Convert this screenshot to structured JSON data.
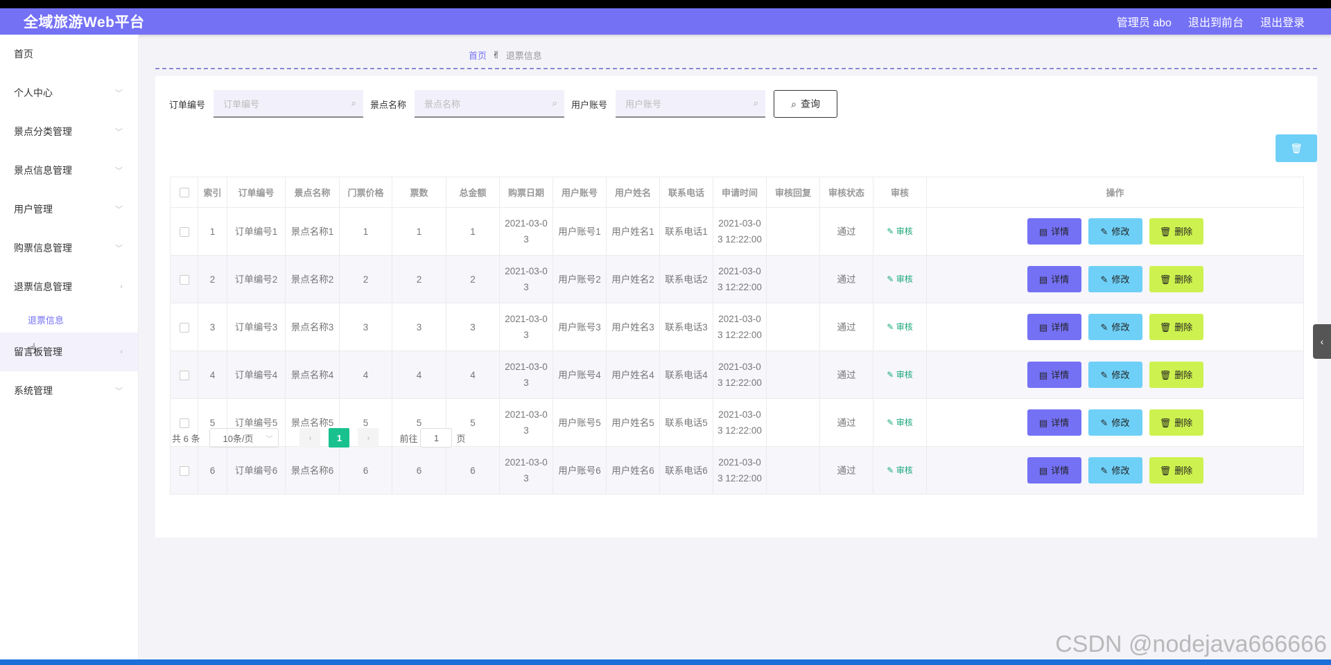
{
  "app": {
    "title": "全域旅游Web平台",
    "admin_label": "管理员 abo",
    "to_front": "退出到前台",
    "logout": "退出登录"
  },
  "sidebar": {
    "items": [
      {
        "label": "首页",
        "chevron": ""
      },
      {
        "label": "个人中心",
        "chevron": "﹀"
      },
      {
        "label": "景点分类管理",
        "chevron": "﹀"
      },
      {
        "label": "景点信息管理",
        "chevron": "﹀"
      },
      {
        "label": "用户管理",
        "chevron": "﹀"
      },
      {
        "label": "购票信息管理",
        "chevron": "﹀"
      },
      {
        "label": "退票信息管理",
        "chevron": "‹"
      },
      {
        "label": "留言板管理",
        "chevron": "‹"
      },
      {
        "label": "系统管理",
        "chevron": "﹀"
      }
    ],
    "submenu": "退票信息"
  },
  "breadcrumb": {
    "home": "首页",
    "icon": "✌",
    "current": "退票信息"
  },
  "search": {
    "order_label": "订单编号",
    "order_placeholder": "订单编号",
    "spot_label": "景点名称",
    "spot_placeholder": "景点名称",
    "user_label": "用户账号",
    "user_placeholder": "用户账号",
    "query_label": "查询",
    "search_icon": "⌕"
  },
  "table": {
    "headers": [
      "索引",
      "订单编号",
      "景点名称",
      "门票价格",
      "票数",
      "总金额",
      "购票日期",
      "用户账号",
      "用户姓名",
      "联系电话",
      "申请时间",
      "审核回复",
      "审核状态",
      "审核",
      "操作"
    ],
    "rows": [
      {
        "idx": "1",
        "order": "订单编号1",
        "spot": "景点名称1",
        "price": "1",
        "count": "1",
        "total": "1",
        "date": "2021-03-0\n3",
        "account": "用户账号1",
        "name": "用户姓名1",
        "phone": "联系电话1",
        "apply": "2021-03-0\n3 12:22:00",
        "reply": "",
        "status": "通过",
        "review": "审核"
      },
      {
        "idx": "2",
        "order": "订单编号2",
        "spot": "景点名称2",
        "price": "2",
        "count": "2",
        "total": "2",
        "date": "2021-03-0\n3",
        "account": "用户账号2",
        "name": "用户姓名2",
        "phone": "联系电话2",
        "apply": "2021-03-0\n3 12:22:00",
        "reply": "",
        "status": "通过",
        "review": "审核"
      },
      {
        "idx": "3",
        "order": "订单编号3",
        "spot": "景点名称3",
        "price": "3",
        "count": "3",
        "total": "3",
        "date": "2021-03-0\n3",
        "account": "用户账号3",
        "name": "用户姓名3",
        "phone": "联系电话3",
        "apply": "2021-03-0\n3 12:22:00",
        "reply": "",
        "status": "通过",
        "review": "审核"
      },
      {
        "idx": "4",
        "order": "订单编号4",
        "spot": "景点名称4",
        "price": "4",
        "count": "4",
        "total": "4",
        "date": "2021-03-0\n3",
        "account": "用户账号4",
        "name": "用户姓名4",
        "phone": "联系电话4",
        "apply": "2021-03-0\n3 12:22:00",
        "reply": "",
        "status": "通过",
        "review": "审核"
      },
      {
        "idx": "5",
        "order": "订单编号5",
        "spot": "景点名称5",
        "price": "5",
        "count": "5",
        "total": "5",
        "date": "2021-03-0\n3",
        "account": "用户账号5",
        "name": "用户姓名5",
        "phone": "联系电话5",
        "apply": "2021-03-0\n3 12:22:00",
        "reply": "",
        "status": "通过",
        "review": "审核"
      },
      {
        "idx": "6",
        "order": "订单编号6",
        "spot": "景点名称6",
        "price": "6",
        "count": "6",
        "total": "6",
        "date": "2021-03-0\n3",
        "account": "用户账号6",
        "name": "用户姓名6",
        "phone": "联系电话6",
        "apply": "2021-03-0\n3 12:22:00",
        "reply": "",
        "status": "通过",
        "review": "审核"
      }
    ],
    "actions": {
      "detail": "详情",
      "edit": "修改",
      "delete": "删除"
    }
  },
  "pagination": {
    "total": "共 6 条",
    "page_size": "10条/页",
    "current_page": "1",
    "goto_label": "前往",
    "goto_value": "1",
    "page_suffix": "页"
  },
  "watermark": "CSDN @nodejava666666",
  "colors": {
    "accent": "#7471f5",
    "edit": "#6fd0f7",
    "delete": "#cdf24f",
    "pager": "#18c18e",
    "review": "#1aa77b"
  }
}
